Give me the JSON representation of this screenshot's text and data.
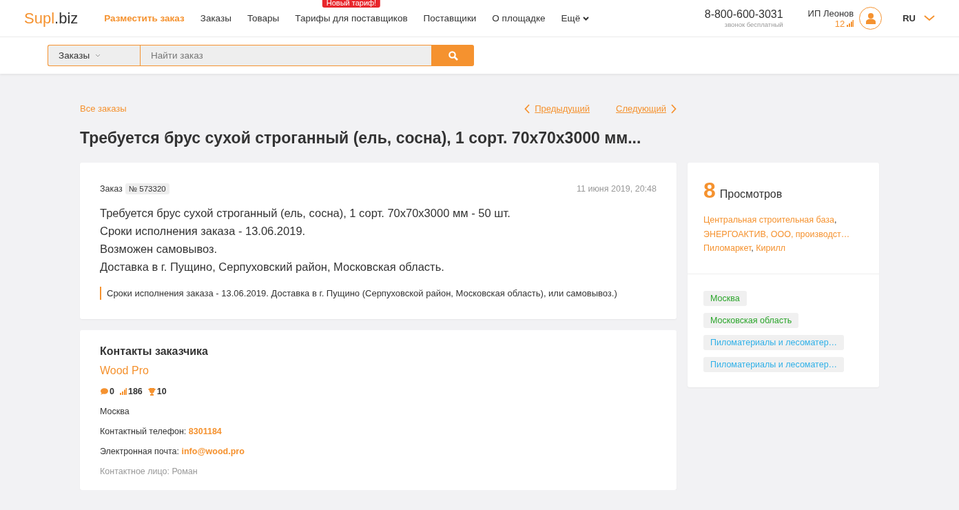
{
  "header": {
    "logo": {
      "main": "Supl",
      "suffix": ".biz"
    },
    "nav": [
      {
        "label": "Разместить заказ",
        "selected": true
      },
      {
        "label": "Заказы",
        "selected": false
      },
      {
        "label": "Товары",
        "selected": false
      },
      {
        "label": "Тарифы для поставщиков",
        "selected": false,
        "badge": "Новый тариф!"
      },
      {
        "label": "Поставщики",
        "selected": false
      },
      {
        "label": "О площадке",
        "selected": false
      },
      {
        "label": "Ещё",
        "selected": false,
        "dropdown": true
      }
    ],
    "phone": "8-800-600-3031",
    "phone_note": "звонок бесплатный",
    "user": {
      "name": "ИП Леонов",
      "rating": "12"
    },
    "language": "RU"
  },
  "search": {
    "scope": "Заказы",
    "placeholder": "Найти заказ"
  },
  "breadcrumb": {
    "all": "Все заказы",
    "prev": "Предыдущий",
    "next": "Следующий"
  },
  "title": "Требуется брус сухой строганный (ель, сосна), 1 сорт. 70х70х3000 мм...",
  "order": {
    "label": "Заказ",
    "number": "№ 573320",
    "date": "11 июня 2019, 20:48",
    "lines": [
      "Требуется брус сухой строганный (ель, сосна), 1 сорт. 70х70х3000 мм - 50 шт.",
      "Сроки исполнения заказа - 13.06.2019.",
      "Возможен самовывоз.",
      "Доставка в г. Пущино, Серпуховский район, Московская область."
    ],
    "quote": "Сроки исполнения заказа - 13.06.2019. Доставка в г. Пущино (Серпуховской район, Московская область), или самовывоз.)"
  },
  "contacts": {
    "heading": "Контакты заказчика",
    "company": "Wood Pro",
    "stats": {
      "comments": "0",
      "rating": "186",
      "awards": "10"
    },
    "city": "Москва",
    "fields": [
      {
        "label": "Контактный телефон:",
        "value": "8301184",
        "kind": "link"
      },
      {
        "label": "Электронная почта:",
        "value": "info@wood.pro",
        "kind": "link"
      },
      {
        "label": "Контактное лицо: Роман",
        "kind": "muted"
      }
    ]
  },
  "views": {
    "count": "8",
    "label": "Просмотров",
    "viewers": [
      {
        "name": "Центральная строительная база",
        "separator": ","
      },
      {
        "name": "ЭНЕРГОАКТИВ, ООО, производст…"
      },
      {
        "name": "Пиломаркет",
        "separator": ","
      },
      {
        "name": "Кирилл"
      }
    ]
  },
  "tags": [
    {
      "label": "Москва",
      "color": "#2aa52a"
    },
    {
      "label": "Московская область",
      "color": "#2aa52a"
    },
    {
      "label": "Пиломатериалы и лесоматер…",
      "color": "#2fb0e8"
    },
    {
      "label": "Пиломатериалы и лесоматер…",
      "color": "#2fb0e8"
    }
  ]
}
